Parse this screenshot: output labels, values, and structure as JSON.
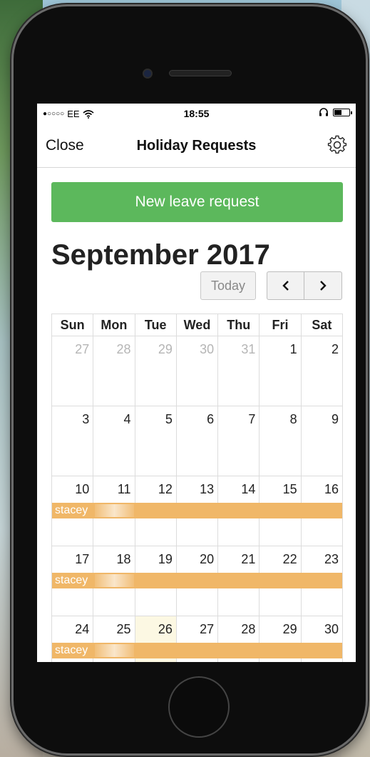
{
  "status_bar": {
    "signal": "●○○○○",
    "carrier": "EE",
    "time": "18:55"
  },
  "nav": {
    "close_label": "Close",
    "title": "Holiday Requests"
  },
  "new_leave_label": "New leave request",
  "month_title": "September 2017",
  "today_label": "Today",
  "prev_label": "<",
  "next_label": ">",
  "weekdays": [
    "Sun",
    "Mon",
    "Tue",
    "Wed",
    "Thu",
    "Fri",
    "Sat"
  ],
  "weeks": [
    {
      "days": [
        "27",
        "28",
        "29",
        "30",
        "31",
        "1",
        "2"
      ]
    },
    {
      "days": [
        "3",
        "4",
        "5",
        "6",
        "7",
        "8",
        "9"
      ]
    },
    {
      "days": [
        "10",
        "11",
        "12",
        "13",
        "14",
        "15",
        "16"
      ],
      "event": "stacey"
    },
    {
      "days": [
        "17",
        "18",
        "19",
        "20",
        "21",
        "22",
        "23"
      ],
      "event": "stacey"
    },
    {
      "days": [
        "24",
        "25",
        "26",
        "27",
        "28",
        "29",
        "30"
      ],
      "event": "stacey"
    }
  ],
  "event_color": "#f0b768",
  "button_color": "#5cb85c",
  "today_highlight_color": "#fcf8e3"
}
